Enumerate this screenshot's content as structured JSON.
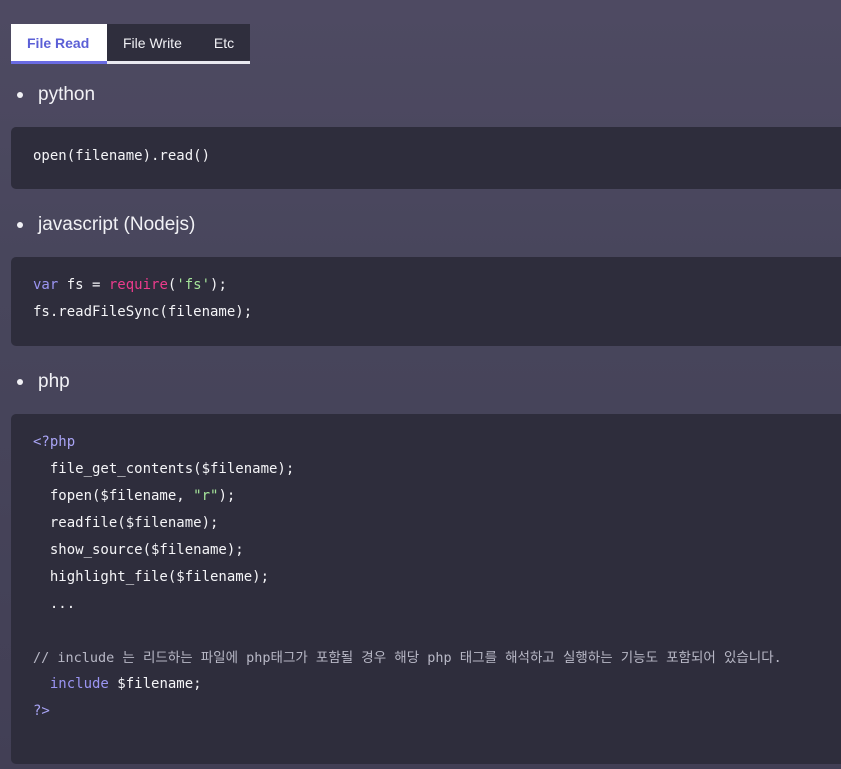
{
  "tabs": [
    {
      "label": "File Read",
      "active": true
    },
    {
      "label": "File Write",
      "active": false
    },
    {
      "label": "Etc",
      "active": false
    }
  ],
  "sections": [
    {
      "title": "python",
      "code": [
        "open(filename).read()"
      ]
    },
    {
      "title": "javascript (Nodejs)",
      "code": {
        "line1_var": "var",
        "line1_mid": " fs = ",
        "line1_require": "require",
        "line1_open": "(",
        "line1_str": "'fs'",
        "line1_close": ");",
        "line2": "fs.readFileSync(filename);"
      }
    },
    {
      "title": "php",
      "code": {
        "open_tag": "<?php",
        "l1": "  file_get_contents($filename);",
        "l2_pre": "  fopen($filename, ",
        "l2_str": "\"r\"",
        "l2_post": ");",
        "l3": "  readfile($filename);",
        "l4": "  show_source($filename);",
        "l5": "  highlight_file($filename);",
        "l6": "  ...",
        "comment": " // include 는 리드하는 파일에 php태그가 포함될 경우 해당 php 태그를 해석하고 실행하는 기능도 포함되어 있습니다.",
        "include_kw": "include",
        "include_rest": " $filename;",
        "close_tag": "?>"
      }
    }
  ],
  "colors": {
    "background": "#48465c",
    "code_bg": "#2e2d3c",
    "active_tab_text": "#5b5fd6",
    "keyword": "#9b95f2",
    "require": "#ec3b8c",
    "string": "#a5e59a"
  }
}
